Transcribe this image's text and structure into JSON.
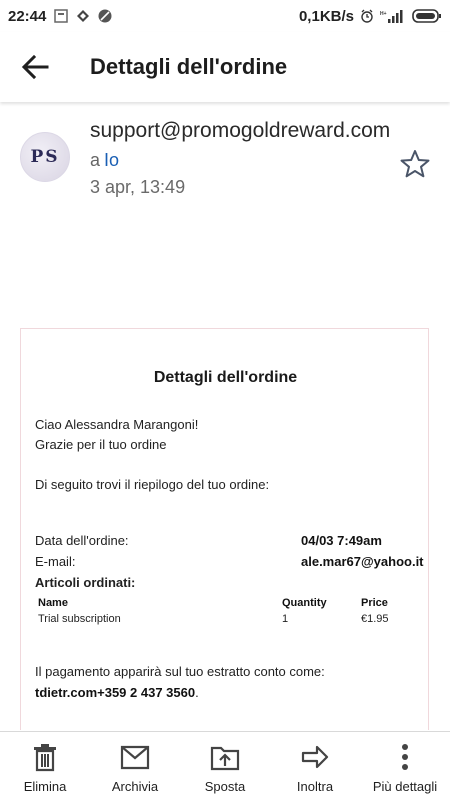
{
  "status_bar": {
    "time": "22:44",
    "net_speed": "0,1KB/s"
  },
  "app_bar": {
    "title": "Dettagli dell'ordine",
    "back_icon": "arrow-left-icon"
  },
  "message": {
    "avatar_initials": "PS",
    "sender_email": "support@promogoldreward.com",
    "to_prefix": "a",
    "to_name": "Io",
    "date": "3 apr, 13:49",
    "star_icon": "star-outline-icon"
  },
  "email_body": {
    "title": "Dettagli dell'ordine",
    "greeting": "Ciao Alessandra Marangoni!",
    "thanks": "Grazie per il tuo ordine",
    "summary_intro": "Di seguito trovi il riepilogo del tuo ordine:",
    "order_date_label": "Data dell'ordine:",
    "order_date_value": "04/03 7:49am",
    "email_label": "E-mail:",
    "email_value": "ale.mar67@yahoo.it",
    "items_label": "Articoli ordinati:",
    "table": {
      "columns": [
        "Name",
        "Quantity",
        "Price"
      ],
      "rows": [
        [
          "Trial subscription",
          "1",
          "€1.95"
        ]
      ]
    },
    "payment_text": "Il pagamento apparirà sul tuo estratto conto come: ",
    "payment_descriptor": "tdietr.com+359 2 437 3560",
    "payment_end": "."
  },
  "bottom_bar": {
    "items": [
      {
        "label": "Elimina",
        "icon": "trash-icon"
      },
      {
        "label": "Archivia",
        "icon": "archive-icon"
      },
      {
        "label": "Sposta",
        "icon": "move-icon"
      },
      {
        "label": "Inoltra",
        "icon": "forward-icon"
      },
      {
        "label": "Più dettagli",
        "icon": "more-vert-icon"
      }
    ]
  }
}
